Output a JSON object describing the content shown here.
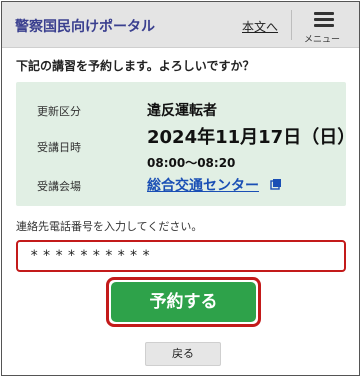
{
  "header": {
    "title": "警察国民向けポータル",
    "main_link": "本文へ",
    "menu_label": "メニュー"
  },
  "prompt": "下記の講習を予約します。よろしいですか？",
  "info": {
    "category_label": "更新区分",
    "category_value": "違反運転者",
    "datetime_label": "受講日時",
    "date_value": "2024年11月17日（日）",
    "time_value": "08:00〜08:20",
    "venue_label": "受講会場",
    "venue_value": "総合交通センター"
  },
  "phone": {
    "label": "連絡先電話番号を入力してください。",
    "value": "**********"
  },
  "buttons": {
    "reserve": "予約する",
    "back": "戻る"
  },
  "colors": {
    "header_bg": "#e4e4e4",
    "title": "#3a3f8f",
    "info_bg": "#e1efe4",
    "reserve_bg": "#2ea24a",
    "highlight": "#c31a1a",
    "link": "#1a4fb5"
  },
  "icons": {
    "menu": "hamburger-icon",
    "external": "external-link-icon"
  }
}
